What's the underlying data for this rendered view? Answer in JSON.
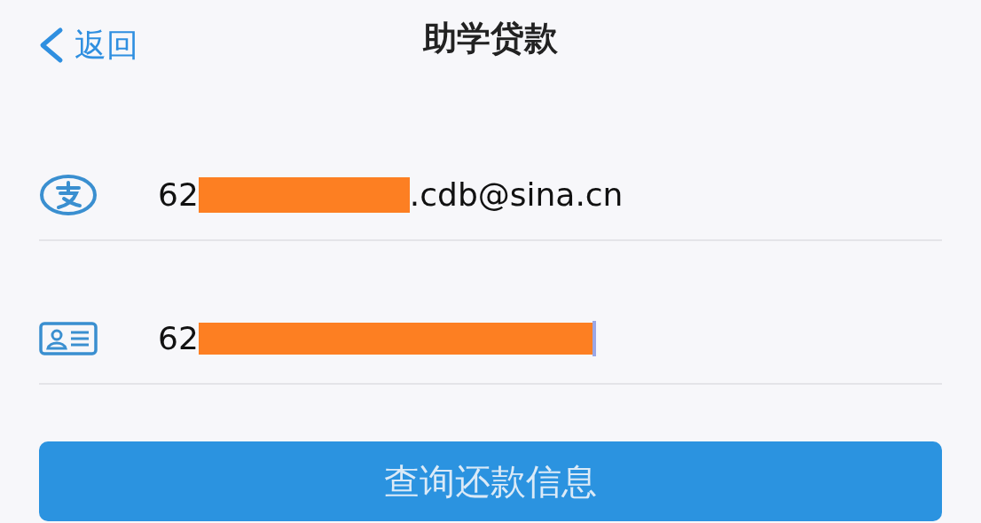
{
  "header": {
    "back": "返回",
    "title": "助学贷款"
  },
  "fields": [
    {
      "kind": "account",
      "prefix": "62",
      "suffix": ".cdb@sina.cn",
      "focused": false
    },
    {
      "kind": "id",
      "prefix": "62",
      "focused": true
    }
  ],
  "button": "查询还款信息"
}
